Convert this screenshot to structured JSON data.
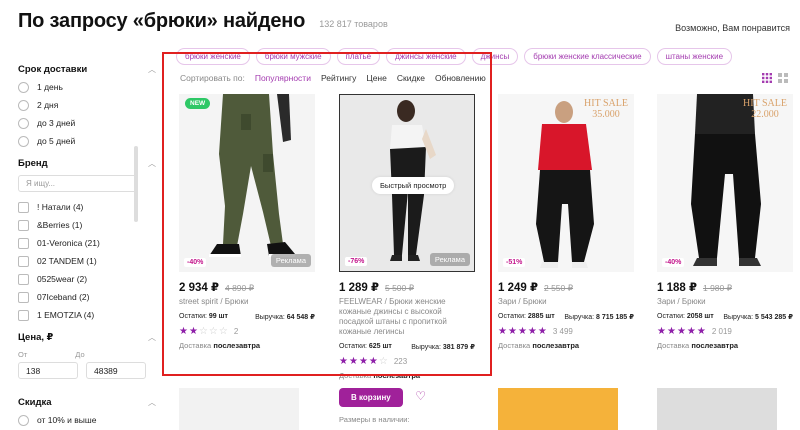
{
  "header": {
    "title": "По запросу «брюки» найдено",
    "count": "132 817 товаров",
    "maybe": "Возможно, Вам понравится"
  },
  "tags": [
    "брюки женские",
    "брюки мужские",
    "платье",
    "джинсы женские",
    "джинсы",
    "брюки женские классические",
    "штаны женские"
  ],
  "sort": {
    "label": "Сортировать по:",
    "options": [
      "Популярности",
      "Рейтингу",
      "Цене",
      "Скидке",
      "Обновлению"
    ],
    "active": "Популярности"
  },
  "sidebar": {
    "delivery": {
      "title": "Срок доставки",
      "options": [
        "1 день",
        "2 дня",
        "до 3 дней",
        "до 5 дней"
      ]
    },
    "brand": {
      "title": "Бренд",
      "placeholder": "Я ищу...",
      "options": [
        "! Натали (4)",
        "&Berries (1)",
        "01-Veronica (21)",
        "02 TANDEM (1)",
        "0525wear (2)",
        "07Iceband (2)",
        "1 EMOTZIA (4)"
      ]
    },
    "price": {
      "title": "Цена, ₽",
      "from_label": "От",
      "to_label": "До",
      "from": "138",
      "to": "48389"
    },
    "discount": {
      "title": "Скидка",
      "option": "от 10% и выше"
    }
  },
  "products": [
    {
      "badge": "NEW",
      "discount": "-40%",
      "ad": "Реклама",
      "price": "2 934 ₽",
      "old_price": "4 890 ₽",
      "brand": "street spirit / Брюки",
      "stock_label": "Остатки:",
      "stock": "99 шт",
      "revenue_label": "Выручка:",
      "revenue": "64 548 ₽",
      "rating": 2,
      "reviews": "2",
      "delivery_label": "Доставка",
      "delivery": "послезавтра"
    },
    {
      "discount": "-76%",
      "ad": "Реклама",
      "quick": "Быстрый просмотр",
      "price": "1 289 ₽",
      "old_price": "5 500 ₽",
      "brand": "FEELWEAR / Брюки женские кожаные джинсы с высокой посадкой штаны с пропиткой кожаные легинсы",
      "stock_label": "Остатки:",
      "stock": "625 шт",
      "revenue_label": "Выручка:",
      "revenue": "381 879 ₽",
      "rating": 4,
      "reviews": "223",
      "delivery_label": "Доставка",
      "delivery": "послезавтра",
      "cart": "В корзину",
      "sizes": "Размеры в наличии:"
    },
    {
      "hit": "HIT SALE",
      "hit_price": "35.000",
      "discount": "-51%",
      "price": "1 249 ₽",
      "old_price": "2 550 ₽",
      "brand": "Зари / Брюки",
      "stock_label": "Остатки:",
      "stock": "2885 шт",
      "revenue_label": "Выручка:",
      "revenue": "8 715 185 ₽",
      "rating": 5,
      "reviews": "3 499",
      "delivery_label": "Доставка",
      "delivery": "послезавтра"
    },
    {
      "hit": "HIT SALE",
      "hit_price": "22.000",
      "discount": "-40%",
      "price": "1 188 ₽",
      "old_price": "1 980 ₽",
      "brand": "Зари / Брюки",
      "stock_label": "Остатки:",
      "stock": "2058 шт",
      "revenue_label": "Выручка:",
      "revenue": "5 543 285 ₽",
      "rating": 5,
      "reviews": "2 019",
      "delivery_label": "Доставка",
      "delivery": "послезавтра"
    }
  ],
  "colors": {
    "accent": "#a43cb0",
    "cart": "#a0219a",
    "discount": "#c3148b",
    "highlight_box": "#e02020",
    "new_badge": "#2ec866"
  }
}
